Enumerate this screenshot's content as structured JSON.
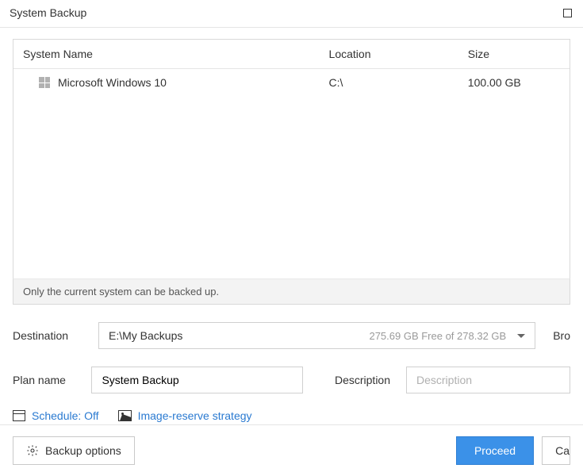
{
  "window": {
    "title": "System Backup"
  },
  "table": {
    "headers": {
      "name": "System Name",
      "location": "Location",
      "size": "Size"
    },
    "rows": [
      {
        "name": "Microsoft Windows 10",
        "location": "C:\\",
        "size": "100.00 GB"
      }
    ],
    "hint": "Only the current system can be backed up."
  },
  "destination": {
    "label": "Destination",
    "path": "E:\\My Backups",
    "free": "275.69 GB Free of 278.32 GB",
    "browse_partial": "Bro"
  },
  "plan": {
    "label": "Plan name",
    "value": "System Backup"
  },
  "description": {
    "label": "Description",
    "placeholder": "Description"
  },
  "links": {
    "schedule": "Schedule: Off",
    "strategy": "Image-reserve strategy"
  },
  "footer": {
    "options": "Backup options",
    "proceed": "Proceed",
    "cancel_partial": "Ca"
  }
}
